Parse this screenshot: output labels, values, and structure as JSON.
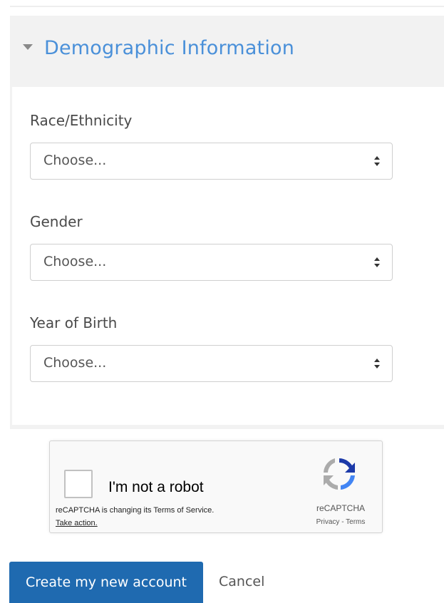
{
  "section": {
    "title": "Demographic Information"
  },
  "fields": [
    {
      "label": "Race/Ethnicity",
      "value": "Choose..."
    },
    {
      "label": "Gender",
      "value": "Choose..."
    },
    {
      "label": "Year of Birth",
      "value": "Choose..."
    }
  ],
  "recaptcha": {
    "checkbox_label": "I'm not a robot",
    "notice": "reCAPTCHA is changing its Terms of Service.",
    "action": "Take action.",
    "brand": "reCAPTCHA",
    "privacy": "Privacy",
    "separator": " - ",
    "terms": "Terms"
  },
  "actions": {
    "submit_label": "Create my new account",
    "cancel_label": "Cancel"
  },
  "colors": {
    "accent": "#4a90d9",
    "primary_button": "#1f6ab0"
  },
  "icons": {
    "section_toggle": "caret-down-icon",
    "select_arrows": "sort-arrows-icon",
    "recaptcha_logo": "recaptcha-logo-icon"
  }
}
